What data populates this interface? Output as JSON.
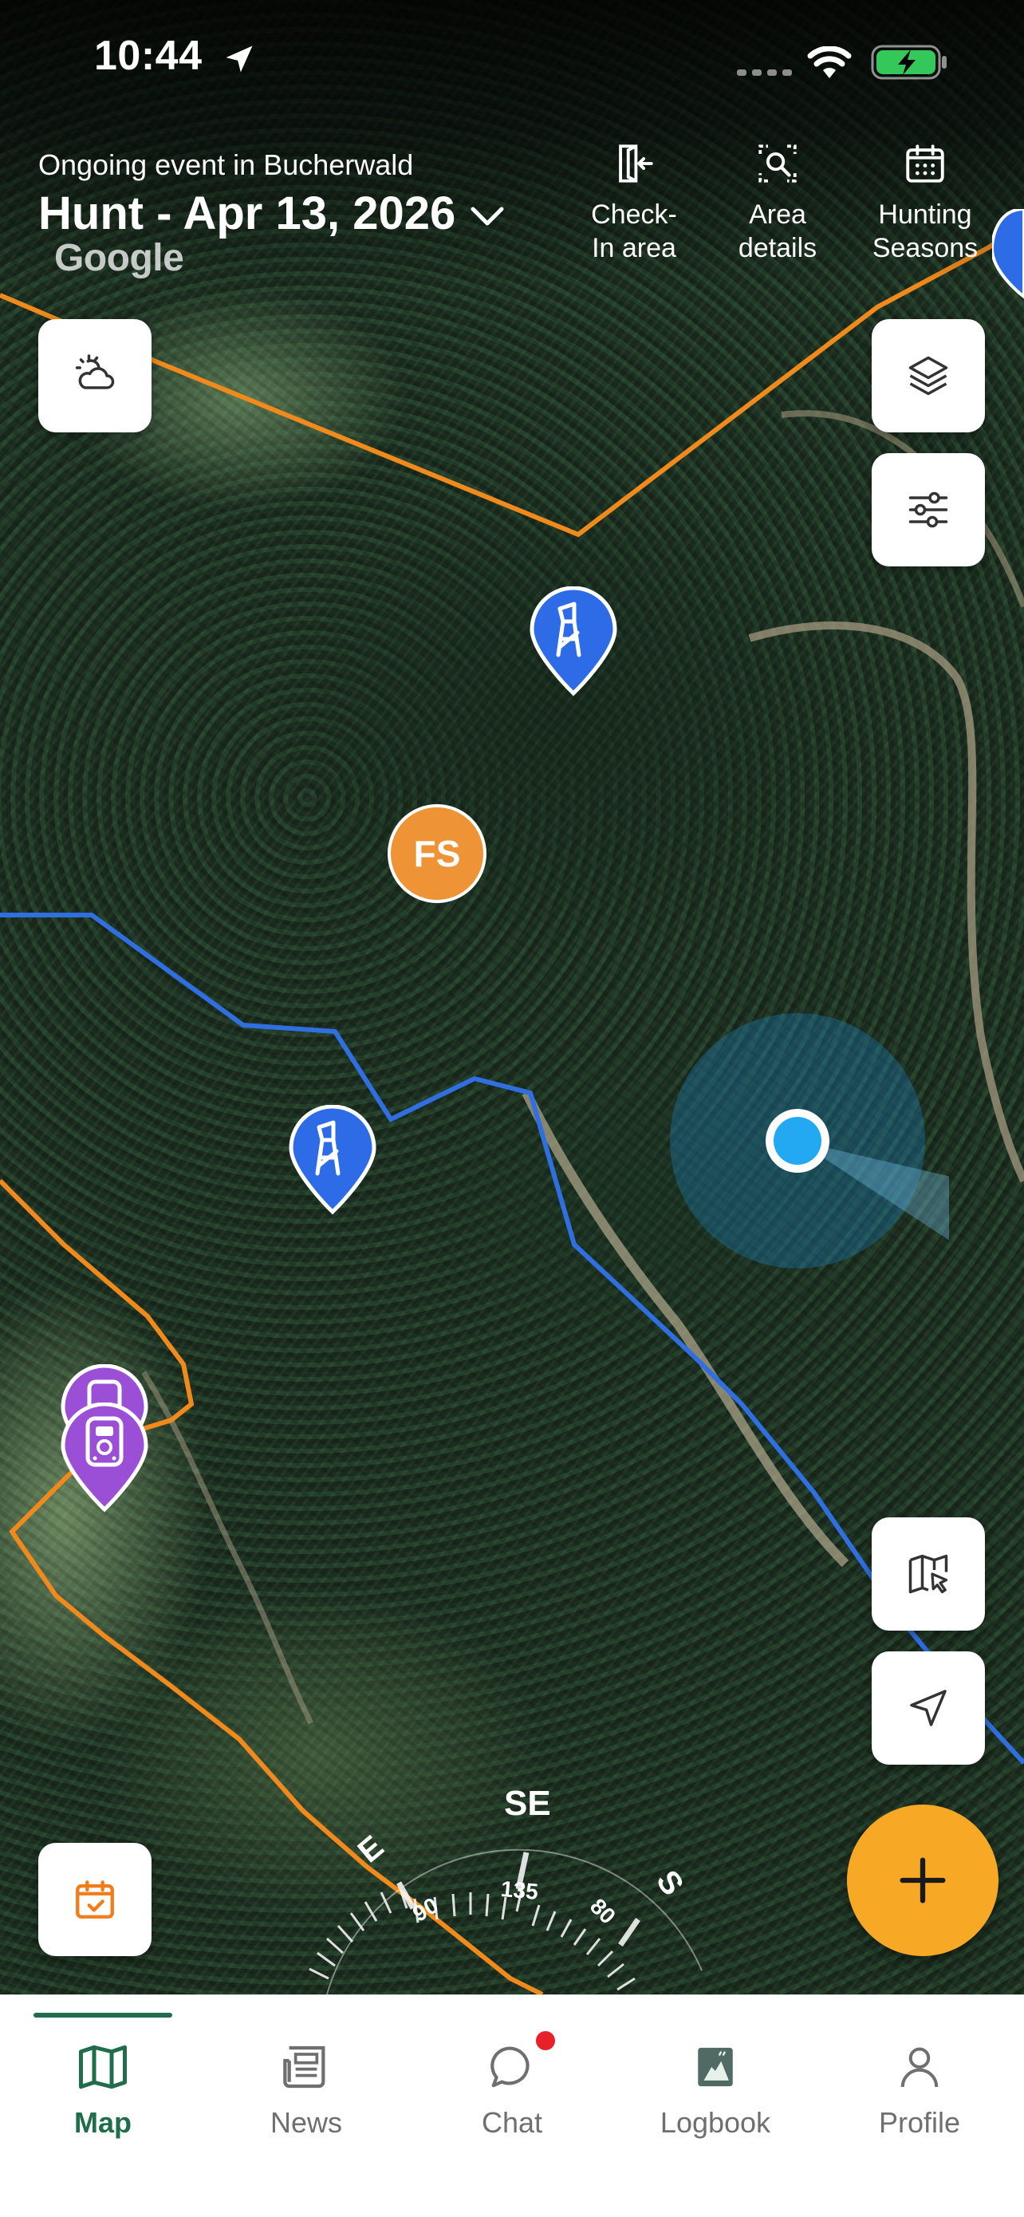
{
  "status_bar": {
    "time": "10:44"
  },
  "header": {
    "event_subtitle": "Ongoing event in Bucherwald",
    "event_title": "Hunt - Apr 13, 2026",
    "actions": [
      {
        "line1": "Check-",
        "line2": "In area",
        "icon": "check-in-door-icon"
      },
      {
        "line1": "Area",
        "line2": "details",
        "icon": "area-search-icon"
      },
      {
        "line1": "Hunting",
        "line2": "Seasons",
        "icon": "calendar-icon"
      }
    ]
  },
  "map": {
    "attribution": "Google",
    "fs_marker_label": "FS",
    "compass": {
      "heading_label": "SE",
      "ticks": [
        "E",
        "90",
        "135",
        "80",
        "S"
      ]
    },
    "colors": {
      "boundary_orange": "#f08a1c",
      "boundary_blue": "#2f6fe0",
      "stand_marker": "#2e6be6",
      "camera_marker": "#9b4fd6",
      "user_location": "#23a9f2",
      "fab": "#f7a824"
    }
  },
  "tabs": [
    {
      "label": "Map",
      "icon": "map-icon",
      "active": true
    },
    {
      "label": "News",
      "icon": "news-icon",
      "active": false
    },
    {
      "label": "Chat",
      "icon": "chat-bubble-icon",
      "active": false
    },
    {
      "label": "Logbook",
      "icon": "logbook-icon",
      "active": false
    },
    {
      "label": "Profile",
      "icon": "person-icon",
      "active": false
    }
  ],
  "brand": {
    "accent": "#1f6d4a"
  }
}
